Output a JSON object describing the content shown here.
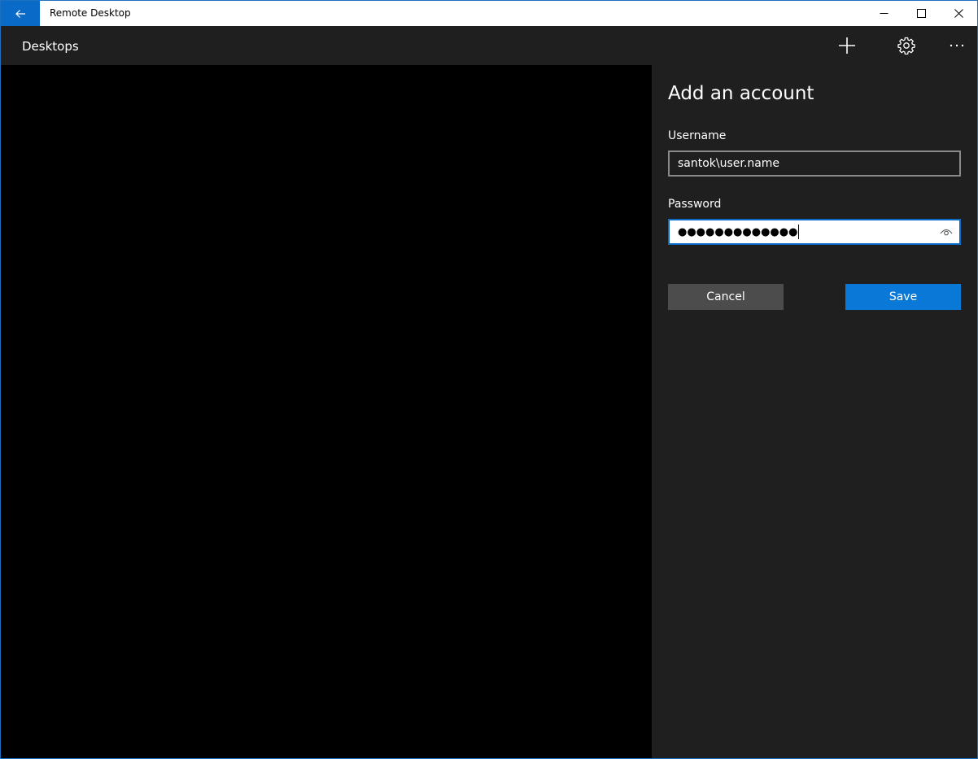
{
  "window": {
    "app_title": "Remote Desktop"
  },
  "appbar": {
    "title": "Desktops"
  },
  "panel": {
    "title": "Add an account",
    "username_label": "Username",
    "username_value": "santok\\user.name",
    "password_label": "Password",
    "password_mask": "●●●●●●●●●●●●●",
    "cancel_label": "Cancel",
    "save_label": "Save"
  },
  "colors": {
    "accent": "#0a78d7",
    "titlebar_back": "#0a6ac8",
    "panel_bg": "#1f1f1f",
    "cancel_bg": "#4c4c4c"
  },
  "icons": [
    "back-arrow-icon",
    "minimize-icon",
    "maximize-icon",
    "close-icon",
    "plus-icon",
    "gear-icon",
    "more-icon",
    "eye-icon"
  ]
}
